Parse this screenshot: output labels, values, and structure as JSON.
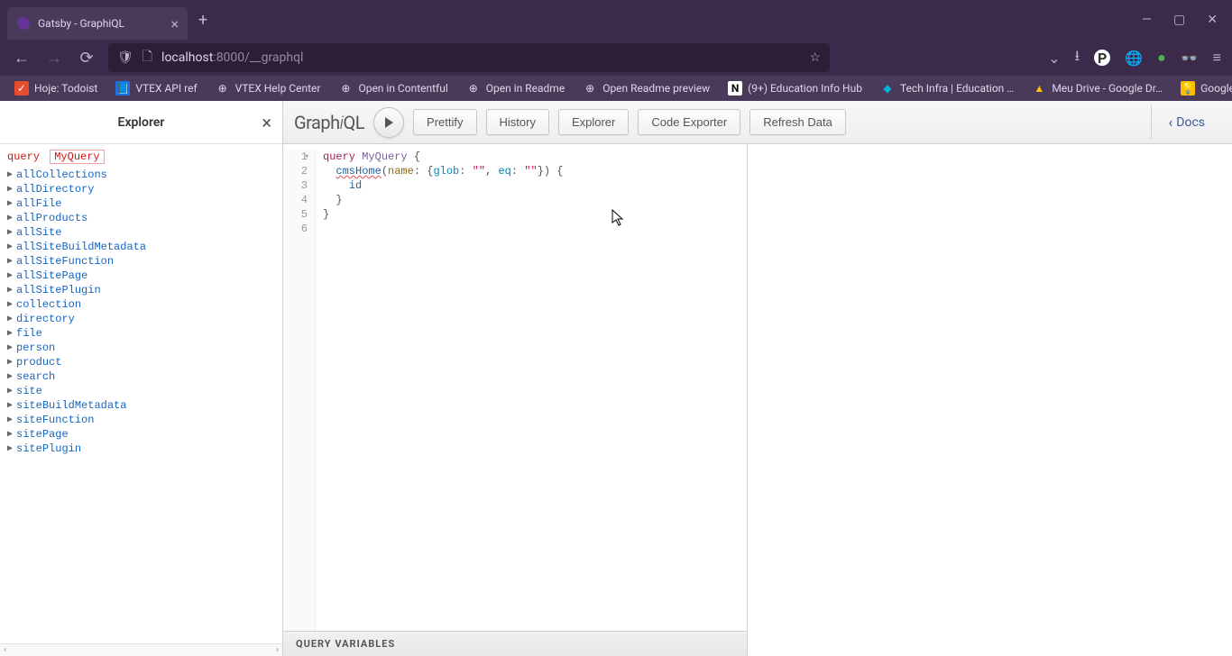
{
  "browser": {
    "tab_title": "Gatsby - GraphiQL",
    "url_host": "localhost",
    "url_port_path": ":8000/__graphql",
    "bookmarks": [
      {
        "label": "Hoje: Todoist",
        "icon": "red"
      },
      {
        "label": "VTEX API ref",
        "icon": "blue"
      },
      {
        "label": "VTEX Help Center",
        "icon": "globe"
      },
      {
        "label": "Open in Contentful",
        "icon": "globe"
      },
      {
        "label": "Open in Readme",
        "icon": "globe"
      },
      {
        "label": "Open Readme preview",
        "icon": "globe"
      },
      {
        "label": "(9+) Education Info Hub",
        "icon": "notion"
      },
      {
        "label": "Tech Infra | Education …",
        "icon": "diamond"
      },
      {
        "label": "Meu Drive - Google Dr…",
        "icon": "drive"
      },
      {
        "label": "Google Keep",
        "icon": "keep"
      }
    ]
  },
  "explorer": {
    "title": "Explorer",
    "query_keyword": "query",
    "query_name": "MyQuery",
    "fields": [
      "allCollections",
      "allDirectory",
      "allFile",
      "allProducts",
      "allSite",
      "allSiteBuildMetadata",
      "allSiteFunction",
      "allSitePage",
      "allSitePlugin",
      "collection",
      "directory",
      "file",
      "person",
      "product",
      "search",
      "site",
      "siteBuildMetadata",
      "siteFunction",
      "sitePage",
      "sitePlugin"
    ]
  },
  "toolbar": {
    "logo_prefix": "Graph",
    "logo_i": "i",
    "logo_suffix": "QL",
    "prettify": "Prettify",
    "history": "History",
    "explorer": "Explorer",
    "code_exporter": "Code Exporter",
    "refresh_data": "Refresh Data",
    "docs": "Docs"
  },
  "editor": {
    "lines": [
      "1",
      "2",
      "3",
      "4",
      "5",
      "6"
    ],
    "tokens": {
      "l1_kw": "query",
      "l1_name": "MyQuery",
      "l2_field": "cmsHome",
      "l2_arg": "name",
      "l2_glob": "glob",
      "l2_eq": "eq",
      "l2_str": "\"\"",
      "l3_id": "id"
    },
    "query_variables": "Query Variables"
  }
}
